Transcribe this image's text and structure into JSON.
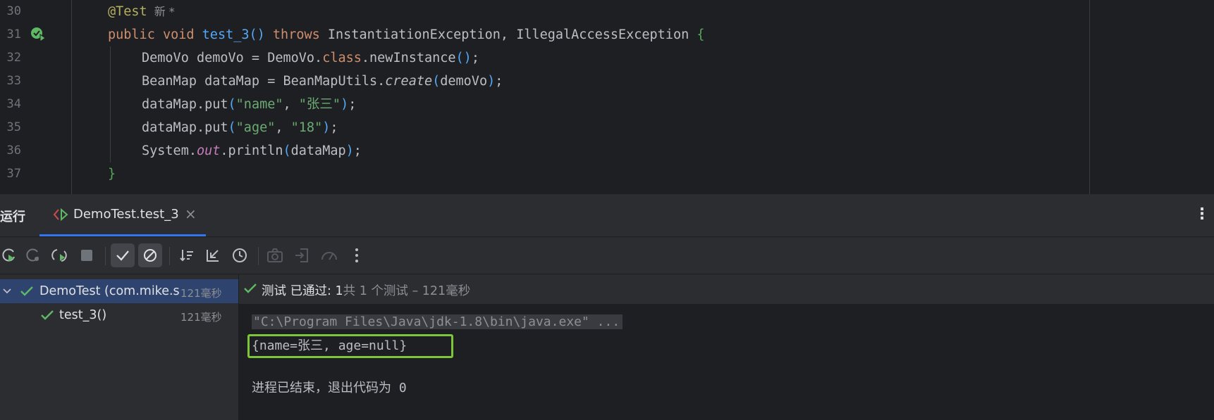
{
  "editor": {
    "line_numbers": [
      "30",
      "31",
      "32",
      "33",
      "34",
      "35",
      "36",
      "37"
    ],
    "line30": {
      "annotation": "@Test",
      "hint": "新 *"
    },
    "line31": {
      "kw_public": "public",
      "kw_void": "void",
      "method": "test_3",
      "parens": "()",
      "kw_throws": "throws",
      "exceptions": "InstantiationException, IllegalAccessException",
      "brace": "{"
    },
    "line32": {
      "t1": "DemoVo demoVo = DemoVo.",
      "kw_class": "class",
      "t2": ".newInstance",
      "p1": "()",
      "semi": ";"
    },
    "line33": {
      "t1": "BeanMap dataMap = BeanMapUtils.",
      "method": "create",
      "p_open": "(",
      "arg": "demoVo",
      "p_close": ")",
      "semi": ";"
    },
    "line34": {
      "t1": "dataMap.put",
      "p_open": "(",
      "s1": "\"name\"",
      "comma": ", ",
      "s2": "\"张三\"",
      "p_close": ")",
      "semi": ";"
    },
    "line35": {
      "t1": "dataMap.put",
      "p_open": "(",
      "s1": "\"age\"",
      "comma": ", ",
      "s2": "\"18\"",
      "p_close": ")",
      "semi": ";"
    },
    "line36": {
      "t1": "System.",
      "field": "out",
      "t2": ".println",
      "p_open": "(",
      "arg": "dataMap",
      "p_close": ")",
      "semi": ";"
    },
    "line37": {
      "brace": "}"
    }
  },
  "run_panel": {
    "title": "运行",
    "tab_label": "DemoTest.test_3",
    "tab_close": "×",
    "menu_icon": "⋮"
  },
  "toolbar": {
    "icons": [
      "rerun-icon",
      "rerun-failed-icon",
      "toggle-auto-test-icon",
      "stop-icon",
      "show-passed-icon",
      "show-ignored-icon",
      "sort-icon",
      "collapse-icon",
      "history-icon",
      "screenshot-icon",
      "import-icon",
      "coverage-icon",
      "more-icon"
    ]
  },
  "tree": {
    "root_label": "DemoTest (com.mike.s",
    "root_duration": "121毫秒",
    "child_label": "test_3()",
    "child_duration": "121毫秒"
  },
  "status": {
    "prefix": "测试 已通过: 1",
    "suffix": "共 1 个测试 – 121毫秒"
  },
  "console": {
    "command": "\"C:\\Program Files\\Java\\jdk-1.8\\bin\\java.exe\" ...",
    "output": "{name=张三, age=null}",
    "exit": "进程已结束，退出代码为 0"
  },
  "colors": {
    "keyword": "#cf8e6d",
    "function": "#56a8f5",
    "string": "#6aab73",
    "annotation": "#b3ae60",
    "field": "#c77dbb",
    "highlight_box": "#7ec639",
    "success": "#5fb865"
  }
}
